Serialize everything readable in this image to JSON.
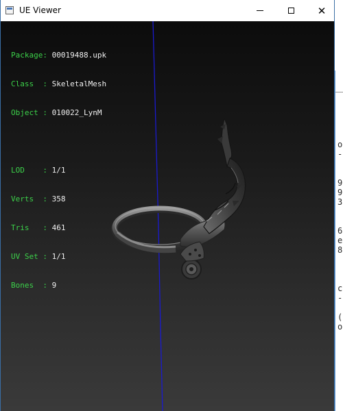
{
  "window": {
    "title": "UE Viewer",
    "controls": {
      "minimize": "minimize",
      "maximize": "maximize",
      "close": "✕"
    }
  },
  "info": {
    "header": [
      {
        "label": "Package: ",
        "value": "00019488.upk"
      },
      {
        "label": "Class  : ",
        "value": "SkeletalMesh"
      },
      {
        "label": "Object : ",
        "value": "010022_LynM"
      }
    ],
    "stats": [
      {
        "label": "LOD    : ",
        "value": "1/1"
      },
      {
        "label": "Verts  : ",
        "value": "358"
      },
      {
        "label": "Tris   : ",
        "value": "461"
      },
      {
        "label": "UV Set : ",
        "value": "1/1"
      },
      {
        "label": "Bones  : ",
        "value": "9"
      }
    ]
  },
  "background_window": {
    "fragments": [
      "o",
      "-",
      "9",
      "9",
      "3",
      "6",
      "e",
      "8",
      "c",
      "-",
      "(",
      "o"
    ]
  },
  "colors": {
    "label": "#3cd24a",
    "value": "#f0f0f0",
    "axis": "#1a1ad0"
  }
}
